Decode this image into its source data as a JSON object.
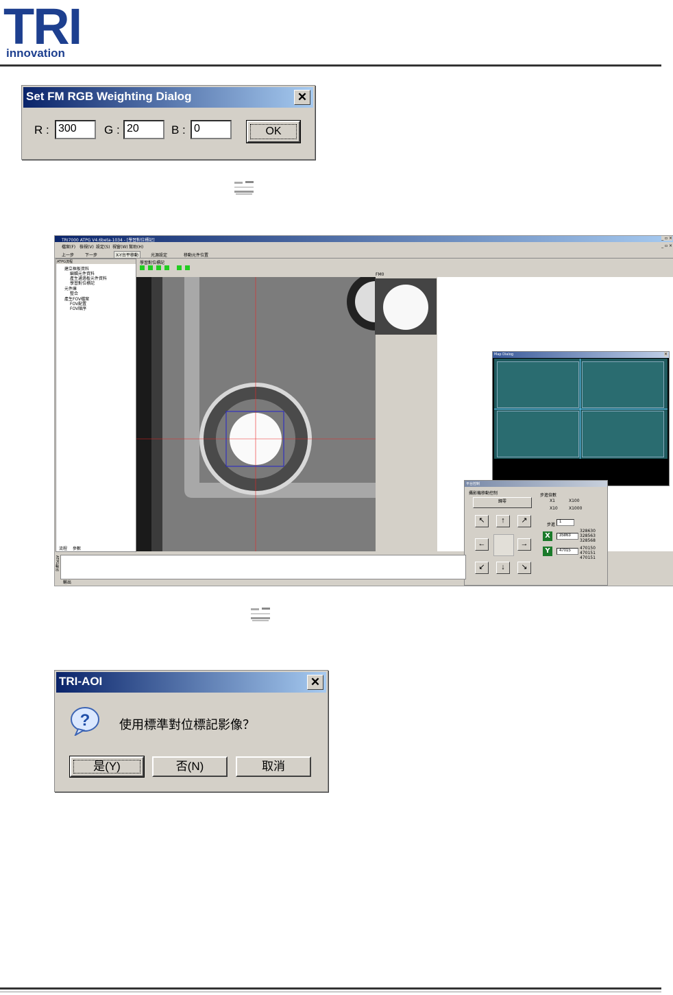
{
  "header": {
    "logo_main": "TRI",
    "logo_sub": "innovation"
  },
  "rgb_dialog": {
    "title": "Set FM RGB Weighting Dialog",
    "r_label": "R :",
    "r_value": "300",
    "g_label": "G :",
    "g_value": "20",
    "b_label": "B :",
    "b_value": "0",
    "ok_label": "OK"
  },
  "app": {
    "title": "TRI7000 ATPG V4.6beta-1034 - [學習對位標記]",
    "menu": [
      "檔案(F)",
      "檢視(V)",
      "設定(S)",
      "視窗(W)",
      "幫助(H)"
    ],
    "toolbar": [
      "上一步",
      "下一步",
      "X-Y台平移動",
      "光源設定",
      "移動元件位置"
    ],
    "panel_title": "ATPG流程",
    "tree": [
      "建立框板資料",
      "編輯元件資料",
      "產生通過板元件資料",
      "學習對位標記",
      "元件庫",
      "整合",
      "產生FOV檔案",
      "FOV配置",
      "FOV順序"
    ],
    "panel_tabs": [
      "流程",
      "參數"
    ],
    "doc_tab": "學習對位標記",
    "fm_label": "FM0",
    "map_title": "Map Dialog",
    "stage_title": "平台控制",
    "stage_group": "攝影機移動控制",
    "stage_zero": "歸零",
    "step_group": "步進倍數",
    "step_opts": [
      "X1",
      "X100",
      "X10",
      "X1000"
    ],
    "step_label": "步進",
    "step_value": "1",
    "x_label": "X",
    "x_value": "35863",
    "x_list": [
      "328630",
      "328563",
      "328568"
    ],
    "y_label": "Y",
    "y_value": "47015",
    "y_list": [
      "470150",
      "470151",
      "470151"
    ],
    "output_label": "ATPG輸出",
    "output_tab": "輸出"
  },
  "aoi_dialog": {
    "title": "TRI-AOI",
    "message": "使用標準對位標記影像？",
    "yes": "是(Y)",
    "no": "否(N)",
    "cancel": "取消"
  }
}
